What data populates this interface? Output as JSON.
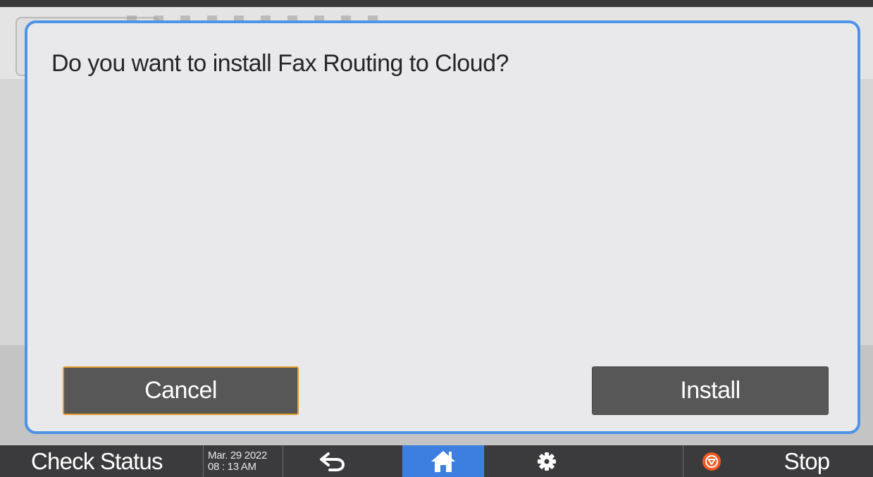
{
  "dialog": {
    "message": "Do you want to install Fax Routing to Cloud?",
    "cancel_label": "Cancel",
    "install_label": "Install"
  },
  "system_bar": {
    "check_status_label": "Check Status",
    "date": "Mar. 29 2022",
    "time": "08 : 13 AM",
    "stop_label": "Stop",
    "icons": {
      "back": "back-arrow-icon",
      "home": "home-icon",
      "settings": "gear-icon",
      "stop": "stop-icon"
    }
  },
  "colors": {
    "dialog_border": "#4d93e6",
    "dialog_background": "#e9e9ec",
    "button_background": "#575757",
    "cancel_focus_border": "#e29a2a",
    "home_active": "#3d7fe0",
    "stop_icon": "#f15a24",
    "system_bar": "#3b3b3d"
  }
}
